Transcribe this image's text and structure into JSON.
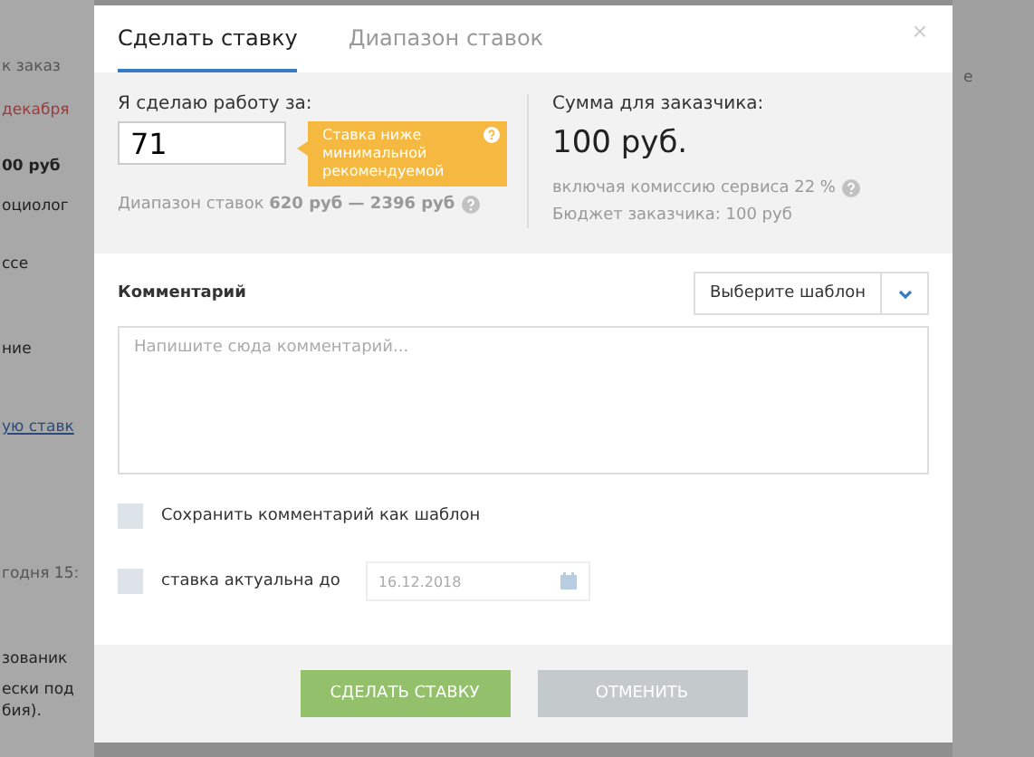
{
  "background_page": {
    "left_fragments": [
      {
        "text": "к заказ",
        "kind": "muted"
      },
      {
        "text": "декабря",
        "kind": "alert"
      },
      {
        "text": "00 руб",
        "kind": "help"
      },
      {
        "text": "оциолог",
        "kind": "plain"
      },
      {
        "text": "ссе",
        "kind": "plain"
      },
      {
        "text": "ние",
        "kind": "plain"
      },
      {
        "text": "ую ставк",
        "kind": "link"
      },
      {
        "text": "годня 15:",
        "kind": "muted"
      },
      {
        "text": "зованик",
        "kind": "plain"
      },
      {
        "text": "ески под",
        "kind": "plain"
      },
      {
        "text": "бия).",
        "kind": "plain"
      }
    ],
    "right_fragments": [
      {
        "text": "е",
        "kind": "muted"
      }
    ]
  },
  "modal": {
    "close": "×",
    "tabs": [
      {
        "label": "Сделать ставку",
        "selected": true
      },
      {
        "label": "Диапазон ставок",
        "selected": false
      }
    ],
    "bid": {
      "label": "Я сделаю работу за:",
      "value": "71",
      "warning": "Ставка ниже минимальной рекомендуемой",
      "range": "Диапазон ставок **620 руб — 2396 руб**"
    },
    "customer": {
      "label": "Сумма для заказчика:",
      "amount": "100 руб.",
      "commission": "включая комиссию сервиса 22 %",
      "budget": "Бюджет заказчика: 100 руб"
    },
    "comment": {
      "label": "Комментарий",
      "template_select": "Выберите шаблон",
      "placeholder": "Напишите сюда комментарий..."
    },
    "options": [
      {
        "kind": "checkbox",
        "label": "Сохранить комментарий как шаблон",
        "checked": false
      },
      {
        "kind": "date",
        "label": "ставка актуальна до",
        "checked": false,
        "placeholder": "16.12.2018"
      }
    ],
    "buttons": [
      {
        "label": "СДЕЛАТЬ СТАВКУ",
        "kind": "primary"
      },
      {
        "label": "ОТМЕНИТЬ",
        "kind": "secondary"
      }
    ]
  }
}
